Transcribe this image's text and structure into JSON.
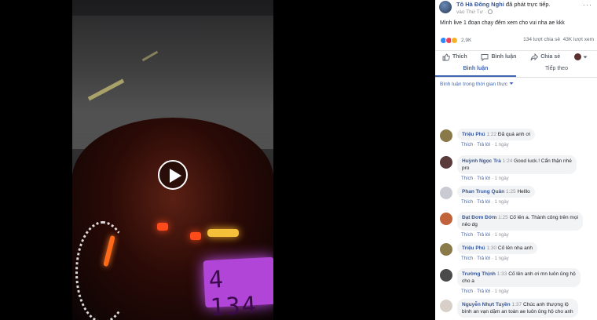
{
  "video": {
    "odometer": "4 134",
    "play_icon": "play-icon"
  },
  "post": {
    "author": "Tô Hà Đông Nghi",
    "action": "đã phát trực tiếp.",
    "time": "vào Thứ Tư ·",
    "caption": "Mình live 1 đoạn chạy đêm xem cho vui nha ae kkk",
    "reaction_count": "2,9K",
    "share_count": "134 lượt chia sẻ",
    "view_count": "43K lượt xem",
    "more_label": "···"
  },
  "actions": {
    "like": "Thích",
    "comment": "Bình luận",
    "share": "Chia sẻ"
  },
  "tabs": {
    "comments": "Bình luận",
    "up_next": "Tiếp theo"
  },
  "filter_label": "Bình luận trong thời gian thực",
  "comment_actions": {
    "like": "Thích",
    "reply": "Trả lời",
    "time": "1 ngày",
    "sep": "·"
  },
  "comments": [
    {
      "name": "Triệu Phú",
      "time": "1:22",
      "text": "Đã quá anh ơi",
      "avatar_color": "#8a7a4a"
    },
    {
      "name": "Huỳnh Ngọc Trà",
      "time": "1:24",
      "text": "Good luck.! Cẩn thận nhé",
      "text2": "pro",
      "avatar_color": "#5a3a3a"
    },
    {
      "name": "Phan Trung Quân",
      "time": "1:25",
      "text": "Helllo",
      "avatar_color": "#c8ccd2"
    },
    {
      "name": "Đạt Đơm Đớm",
      "time": "1:25",
      "text": "Cố lên a. Thành công trên mọi",
      "text2": "nẻo dg",
      "avatar_color": "#c0623a"
    },
    {
      "name": "Triệu Phú",
      "time": "1:30",
      "text": "Cố lên nha anh",
      "avatar_color": "#8a7a4a"
    },
    {
      "name": "Trường Thịnh",
      "time": "1:33",
      "text": "Cố lên anh ơi mn luôn ủng hộ",
      "text2": "cho a",
      "avatar_color": "#4a4a4a"
    },
    {
      "name": "Nguyễn Nhựt Tuyền",
      "time": "1:37",
      "text": "Chúc anh thượng lộ",
      "text2": "bình an vạn dặm an toàn ae luôn ủng hộ cho anh",
      "avatar_color": "#d8d0c8"
    }
  ]
}
